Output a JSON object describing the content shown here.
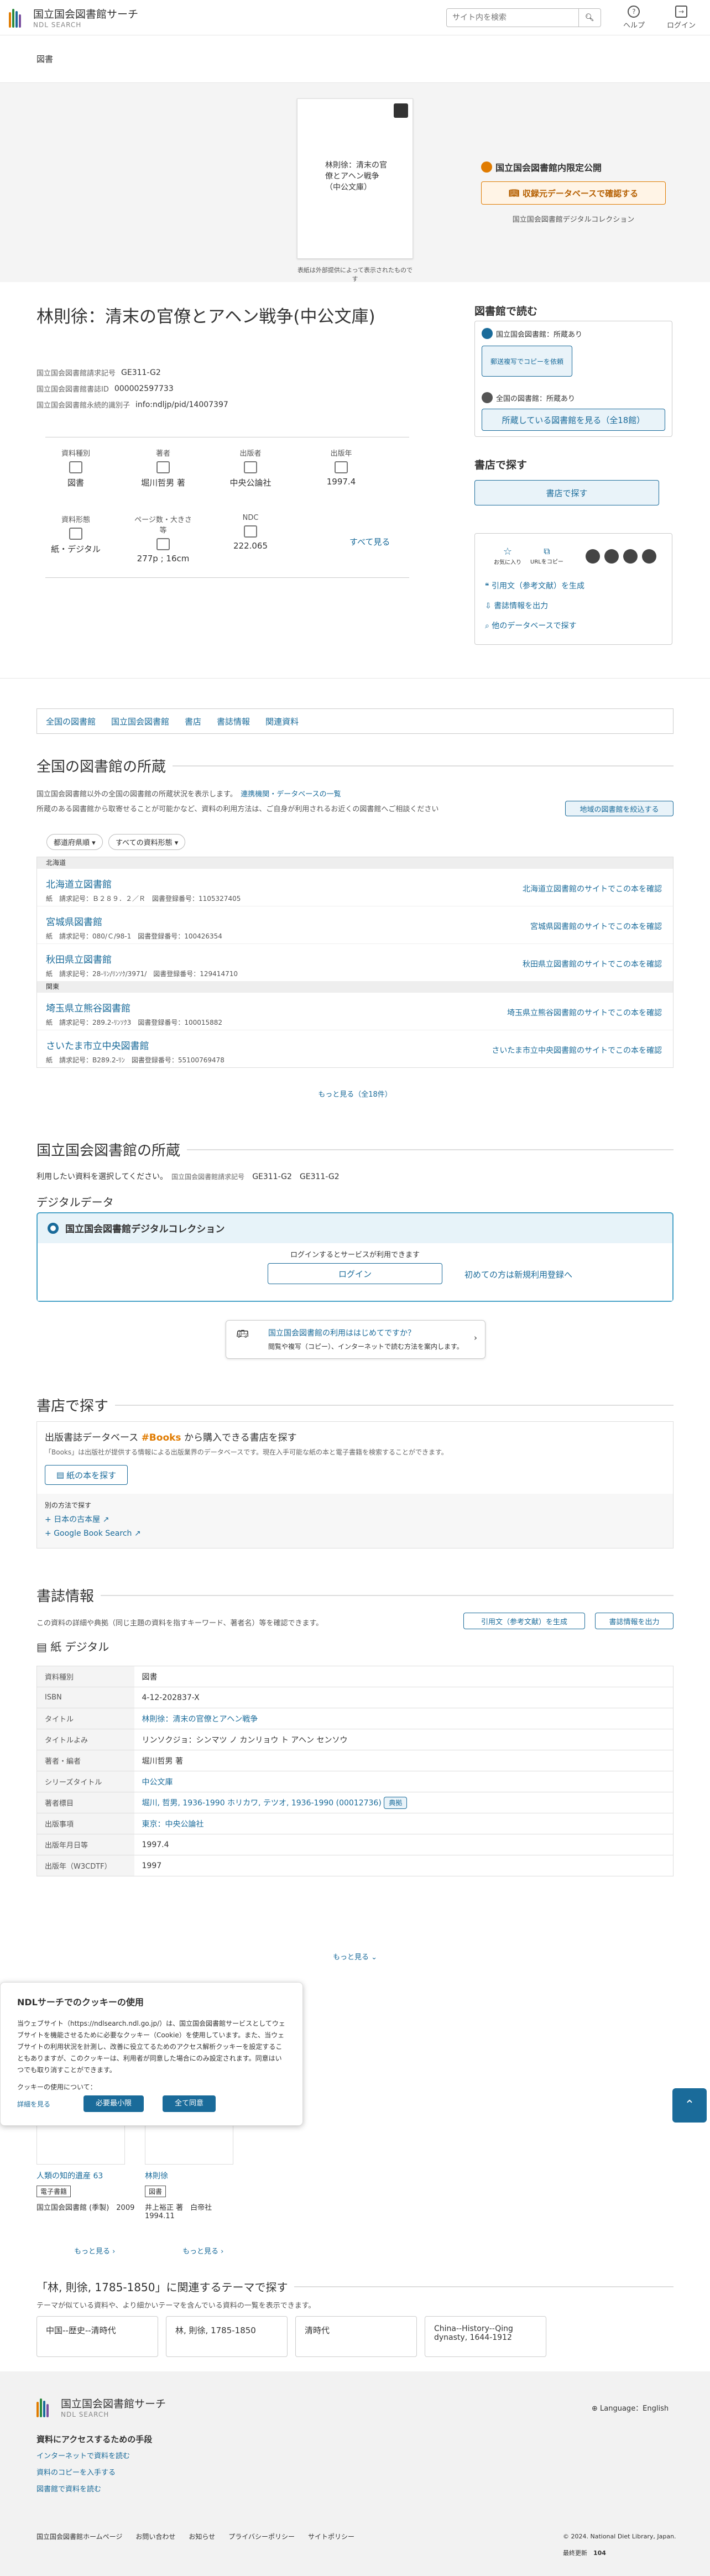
{
  "header": {
    "logo_title": "国立国会図書館サーチ",
    "logo_sub": "NDL SEARCH",
    "search_placeholder": "サイト内を検索",
    "help": "ヘルプ",
    "login": "ログイン"
  },
  "breadcrumb": "図書",
  "cover": {
    "text": "林則徐：清末の官僚とアヘン戦争（中公文庫）",
    "note": "表紙は外部提供によって表示されたものです"
  },
  "dl": {
    "badge": "国立国会図書館内限定公開",
    "button": "収録元データベースで確認する",
    "sub": "国立国会図書館デジタルコレクション"
  },
  "book": {
    "title": "林則徐：清末の官僚とアヘン戦争(中公文庫)",
    "ids": [
      {
        "k": "国立国会図書館請求記号",
        "v": "GE311-G2"
      },
      {
        "k": "国立国会図書館書誌ID",
        "v": "000002597733"
      },
      {
        "k": "国立国会図書館永続的識別子",
        "v": "info:ndljp/pid/14007397"
      }
    ],
    "cells": [
      {
        "k": "資料種別",
        "v": "図書"
      },
      {
        "k": "著者",
        "v": "堀川哲男 著"
      },
      {
        "k": "出版者",
        "v": "中央公論社"
      },
      {
        "k": "出版年",
        "v": "1997.4"
      },
      {
        "k": "資料形態",
        "v": "紙・デジタル"
      },
      {
        "k": "ページ数・大きさ等",
        "v": "277p ; 16cm"
      },
      {
        "k": "NDC",
        "v": "222.065"
      }
    ],
    "see_all": "すべて見る"
  },
  "side": {
    "read_head": "図書館で読む",
    "ndl_label": "国立国会図書館：所蔵あり",
    "copy_btn": "郵送複写でコピーを依頼",
    "all_label": "全国の図書館：所蔵あり",
    "all_btn": "所蔵している図書館を見る（全18館）",
    "store_head": "書店で探す",
    "store_btn": "書店で探す",
    "fav": "お気に入り",
    "url": "URLをコピー",
    "links": [
      "引用文（参考文献）を生成",
      "書誌情報を出力",
      "他のデータベースで探す"
    ]
  },
  "tabs": [
    "全国の図書館",
    "国立国会図書館",
    "書店",
    "書誌情報",
    "関連資料"
  ],
  "libraries": {
    "head": "全国の図書館の所蔵",
    "note1": "国立国会図書館以外の全国の図書館の所蔵状況を表示します。",
    "note1_link": "連携機関・データベースの一覧",
    "note2": "所蔵のある図書館から取寄せることが可能かなど、資料の利用方法は、ご自身が利用されるお近くの図書館へご相談ください",
    "region_btn": "地域の図書館を絞込する",
    "filter1": "都道府県順",
    "filter2": "すべての資料形態",
    "sections": [
      {
        "name": "北海道",
        "rows": [
          {
            "n": "北海道立図書館",
            "m": "紙　請求記号：Ｂ２８９．２／Ｒ　図書登録番号：1105327405"
          },
          {
            "n": "宮城県図書館",
            "m": "紙　請求記号：080/Ｃ/98-1　図書登録番号：100426354"
          },
          {
            "n": "秋田県立図書館",
            "m": "紙　請求記号：28-ﾘﾝ/ﾘﾝｿｸ/3971/　図書登録番号：129414710"
          }
        ]
      },
      {
        "name": "関東",
        "rows": [
          {
            "n": "埼玉県立熊谷図書館",
            "m": "紙　請求記号：289.2-ﾘﾝｿｸ3　図書登録番号：100015882"
          },
          {
            "n": "さいたま市立中央図書館",
            "m": "紙　請求記号：B289.2-ﾘﾝ　図書登録番号：55100769478"
          }
        ]
      }
    ],
    "links": [
      "北海道立図書館のサイトでこの本を確認",
      "宮城県図書館のサイトでこの本を確認",
      "秋田県立図書館のサイトでこの本を確認",
      "埼玉県立熊谷図書館のサイトでこの本を確認",
      "さいたま市立中央図書館のサイトでこの本を確認"
    ],
    "more": "もっと見る（全18件）"
  },
  "ndl": {
    "head": "国立国会図書館の所蔵",
    "select": "利用したい資料を選択してください。",
    "callnum_label": "国立国会図書館請求記号",
    "call1": "GE311-G2",
    "call2": "GE311-G2",
    "digital_head": "デジタルデータ",
    "dc": "国立国会図書館デジタルコレクション",
    "login_note": "ログインするとサービスが利用できます",
    "login_btn": "ログイン",
    "register": "初めての方は新規利用登録へ",
    "banner_t": "国立国会図書館の利用ははじめてですか？",
    "banner_s": "閲覧や複写（コピー）、インターネットで読む方法を案内します。"
  },
  "store": {
    "head": "書店で探す",
    "h": "出版書誌データベース",
    "hb": "#Books",
    "h2": "から購入できる書店を探す",
    "note": "「Books」は出版社が提供する情報による出版業界のデータベースです。現在入手可能な紙の本と電子書籍を検索することができます。",
    "btn": "紙の本を探す",
    "other": "別の方法で探す",
    "l1": "日本の古本屋",
    "l2": "Google Book Search"
  },
  "biblio": {
    "head": "書誌情報",
    "note": "この資料の詳細や典拠（同じ主題の資料を指すキーワード、著者名）等を確認できます。",
    "cite": "引用文（参考文献）を生成",
    "out": "書誌情報を出力",
    "format": "紙 デジタル",
    "rows": [
      {
        "k": "資料種別",
        "v": "図書"
      },
      {
        "k": "ISBN",
        "v": "4-12-202837-X"
      },
      {
        "k": "タイトル",
        "v": "林則徐：清末の官僚とアヘン戦争"
      },
      {
        "k": "タイトルよみ",
        "v": "リンソクジョ：シンマツ ノ カンリョウ ト アヘン センソウ"
      },
      {
        "k": "著者・編者",
        "v": "堀川哲男 著"
      },
      {
        "k": "シリーズタイトル",
        "v": "中公文庫"
      },
      {
        "k": "著者標目",
        "v": "堀川, 哲男, 1936-1990 ホリカワ, テツオ, 1936-1990 (00012736)"
      },
      {
        "k": "出版事項",
        "v": "東京：中央公論社"
      },
      {
        "k": "出版年月日等",
        "v": "1997.4"
      },
      {
        "k": "出版年（W3CDTF）",
        "v": "1997"
      }
    ],
    "typical": "典拠",
    "more": "もっと見る"
  },
  "cookie": {
    "title": "NDLサーチでのクッキーの使用",
    "body": "当ウェブサイト（https://ndlsearch.ndl.go.jp/）は、国立国会図書館サービスとしてウェブサイトを機能させるために必要なクッキー（Cookie）を使用しています。また、当ウェブサイトの利用状況を計測し、改善に役立てるためのアクセス解析クッキーを設定することもありますが、このクッキーは、利用者が同意した場合にのみ設定されます。同意はいつでも取り消すことができます。",
    "q": "クッキーの使用について：",
    "detail": "詳細を見る",
    "btn1": "必要最小限",
    "btn2": "全て同意"
  },
  "related": [
    {
      "title": "人類の知的遺産 63",
      "tag": "電子書籍",
      "sub": "国立国会図書館 (季製)　2009"
    },
    {
      "title": "林則徐",
      "tag": "図書",
      "sub": "井上裕正 著　白帝社　1994.11"
    }
  ],
  "rel_more": "もっと見る",
  "theme": {
    "head": "「林, 則徐, 1785-1850」に関連するテーマで探す",
    "note": "テーマが似ている資料や、より細かいテーマを含んでいる資料の一覧を表示できます。",
    "items": [
      "中国--歴史--清時代",
      "林, 則徐, 1785-1850",
      "清時代",
      "China--History--Qing dynasty, 1644-1912"
    ]
  },
  "footer": {
    "title": "国立国会図書館サーチ",
    "sub": "NDL SEARCH",
    "lang": "Language：English",
    "h": "資料にアクセスするための手段",
    "links": [
      "インターネットで資料を読む",
      "資料のコピーを入手する",
      "図書館で資料を読む"
    ],
    "bottom": [
      "国立国会図書館ホームページ",
      "お問い合わせ",
      "お知らせ",
      "プライバシーポリシー",
      "サイトポリシー"
    ],
    "copy": "© 2024. National Diet Library, Japan.",
    "count_label": "最終更新",
    "count": "104"
  }
}
